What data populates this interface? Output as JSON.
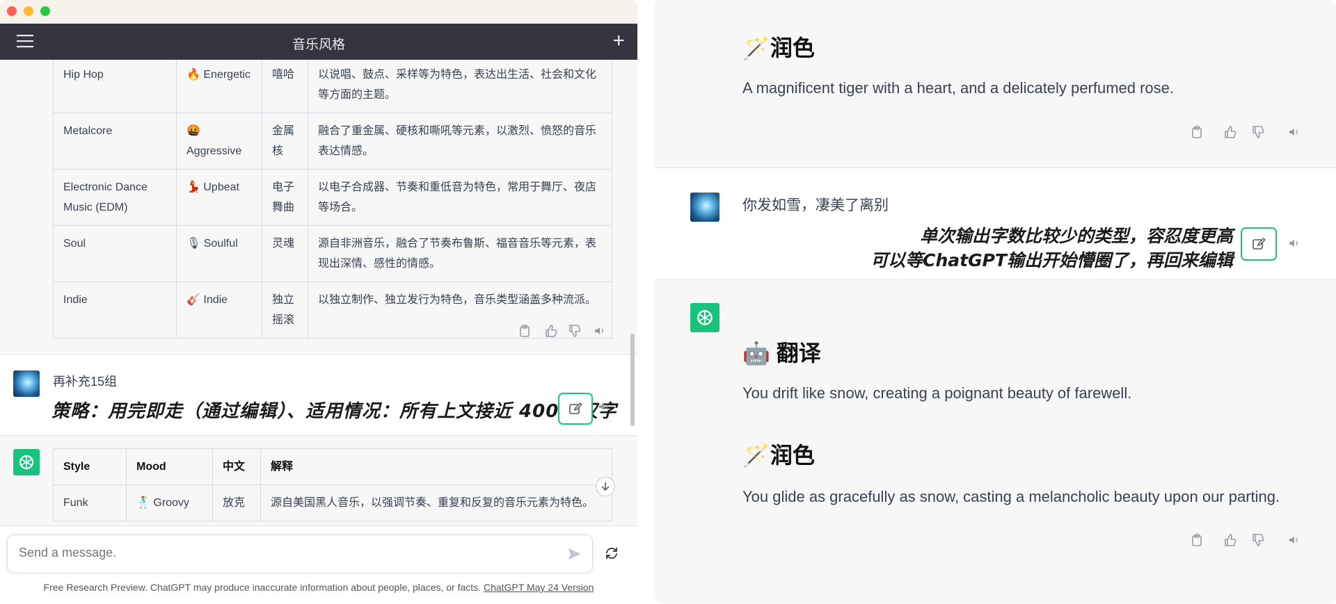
{
  "window": {
    "title": "音乐风格"
  },
  "table1": {
    "rows": [
      {
        "style": "Hip Hop",
        "mood": "🔥 Energetic",
        "chinese": "嘻哈",
        "desc": "以说唱、鼓点、采样等为特色，表达出生活、社会和文化等方面的主题。"
      },
      {
        "style": "Metalcore",
        "mood": "🤬 Aggressive",
        "chinese": "金属核",
        "desc": "融合了重金属、硬核和嘶吼等元素，以激烈、愤怒的音乐表达情感。"
      },
      {
        "style": "Electronic Dance Music (EDM)",
        "mood": "💃 Upbeat",
        "chinese": "电子舞曲",
        "desc": "以电子合成器、节奏和重低音为特色，常用于舞厅、夜店等场合。"
      },
      {
        "style": "Soul",
        "mood": "🎙 Soulful",
        "chinese": "灵魂",
        "desc": "源自非洲音乐，融合了节奏布鲁斯、福音音乐等元素，表现出深情、感性的情感。"
      },
      {
        "style": "Indie",
        "mood": "🎸 Indie",
        "chinese": "独立摇滚",
        "desc": "以独立制作、独立发行为特色，音乐类型涵盖多种流派。"
      }
    ]
  },
  "user_message_left": {
    "text": "再补充15组"
  },
  "annotation_left": {
    "text": "策略：用完即走（通过编辑）、适用情况：所有上文接近 4000 汉字"
  },
  "table2": {
    "headers": [
      "Style",
      "Mood",
      "中文",
      "解释"
    ],
    "rows": [
      {
        "style": "Funk",
        "mood": "🕺 Groovy",
        "chinese": "放克",
        "desc": "源自美国黑人音乐，以强调节奏、重复和反复的音乐元素为特色。"
      }
    ]
  },
  "input": {
    "placeholder": "Send a message."
  },
  "footer": {
    "text": "Free Research Preview. ChatGPT may produce inaccurate information about people, places, or facts.",
    "link": "ChatGPT May 24 Version"
  },
  "right": {
    "heading_polish_1": "🪄润色",
    "text_polish_1": "A magnificent tiger with a heart, and a delicately perfumed rose.",
    "user_message": "你发如雪，凄美了离别",
    "annotation_line1": "单次输出字数比较少的类型，容忍度更高",
    "annotation_line2": "可以等ChatGPT输出开始懵圈了，再回来编辑",
    "heading_translate": "🤖 翻译",
    "text_translate": "You drift like snow, creating a poignant beauty of farewell.",
    "heading_polish_2": "🪄润色",
    "text_polish_2": "You glide as gracefully as snow, casting a melancholic beauty upon our parting."
  },
  "colors": {
    "accent": "#19c37d",
    "appbar": "#343541"
  },
  "icons": [
    "hamburger-menu-icon",
    "plus-icon",
    "clipboard-icon",
    "thumbs-up-icon",
    "thumbs-down-icon",
    "speaker-icon",
    "edit-icon",
    "send-icon",
    "regenerate-icon",
    "scroll-down-icon",
    "chatgpt-logo-icon"
  ]
}
